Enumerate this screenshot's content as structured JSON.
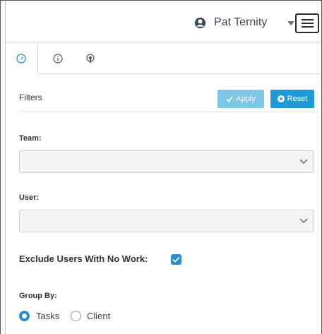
{
  "header": {
    "user_name": "Pat Ternity",
    "user_icon": "user-circle-icon",
    "menu_icon": "hamburger-menu-icon"
  },
  "tabs": [
    {
      "icon": "dashboard-gauge-icon",
      "active": true
    },
    {
      "icon": "info-icon",
      "active": false
    },
    {
      "icon": "podcast-icon",
      "active": false
    }
  ],
  "filters": {
    "title": "Filters",
    "apply_label": "Apply",
    "reset_label": "Reset",
    "team_label": "Team:",
    "team_value": "",
    "user_label": "User:",
    "user_value": "",
    "exclude_label": "Exclude Users With No Work:",
    "exclude_checked": true,
    "group_by_label": "Group By:",
    "group_by_options": [
      "Tasks",
      "Client"
    ],
    "group_by_selected": "Tasks"
  },
  "colors": {
    "accent": "#2a8fc9",
    "apply_button": "#7dc6e6",
    "reset_button": "#1e9bd6"
  }
}
